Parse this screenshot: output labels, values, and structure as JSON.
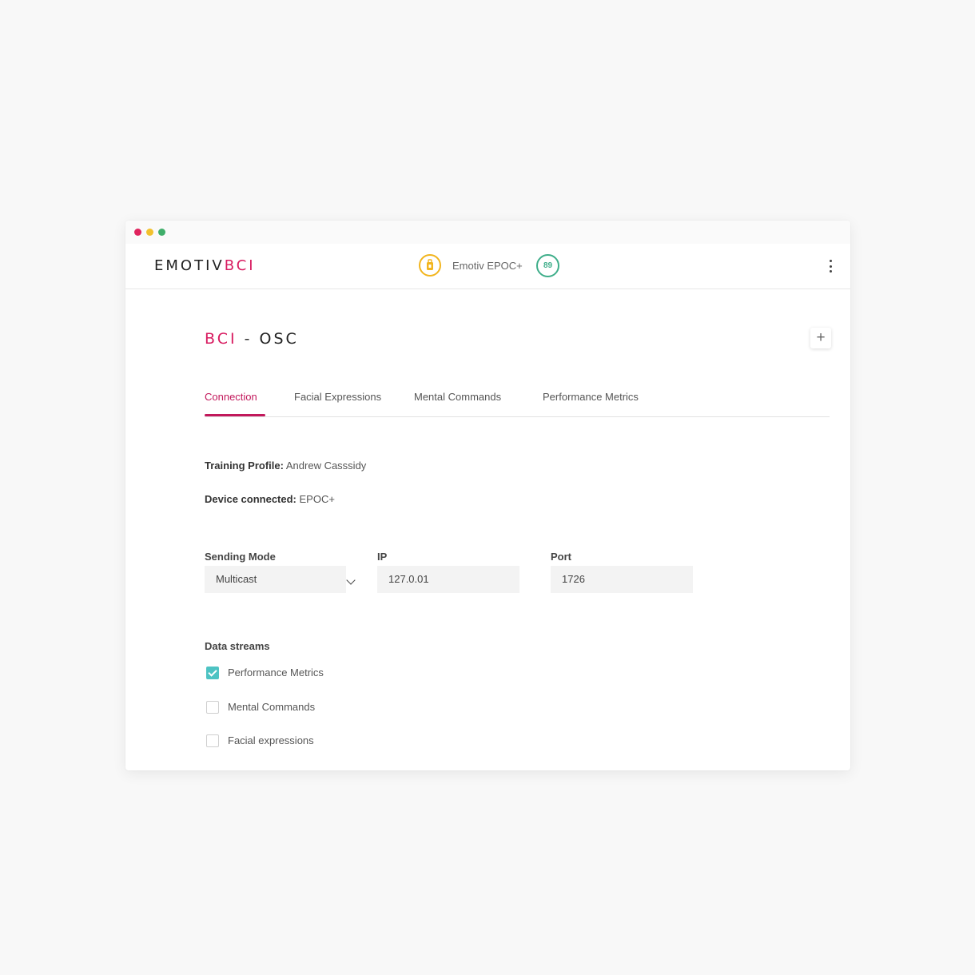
{
  "window": {
    "controls": [
      "close",
      "minimize",
      "maximize"
    ]
  },
  "header": {
    "logo_part1": "EMOTIV",
    "logo_part2": "BCI",
    "headset_icon": "headset-connection-icon",
    "device_name": "Emotiv EPOC+",
    "battery_level": "89",
    "menu_icon": "more-vertical-icon"
  },
  "page": {
    "title_part1": "BCI",
    "title_sep": "-",
    "title_part2": "OSC",
    "add_label": "+"
  },
  "tabs": [
    {
      "label": "Connection",
      "active": true
    },
    {
      "label": "Facial Expressions",
      "active": false
    },
    {
      "label": "Mental Commands",
      "active": false
    },
    {
      "label": "Performance Metrics",
      "active": false
    }
  ],
  "info": {
    "training_profile_label": "Training Profile:",
    "training_profile_value": "Andrew Casssidy",
    "device_label": "Device connected:",
    "device_value": "EPOC+"
  },
  "form": {
    "sending_mode_label": "Sending Mode",
    "sending_mode_value": "Multicast",
    "ip_label": "IP",
    "ip_value": "127.0.01",
    "port_label": "Port",
    "port_value": "1726"
  },
  "data_streams": {
    "label": "Data streams",
    "items": [
      {
        "label": "Performance Metrics",
        "checked": true
      },
      {
        "label": "Mental Commands",
        "checked": false
      },
      {
        "label": "Facial expressions",
        "checked": false
      }
    ]
  },
  "colors": {
    "accent": "#d81b60",
    "checkbox_checked": "#4dc3c3",
    "battery": "#3fae8a",
    "headset_warning": "#f2b51e"
  }
}
